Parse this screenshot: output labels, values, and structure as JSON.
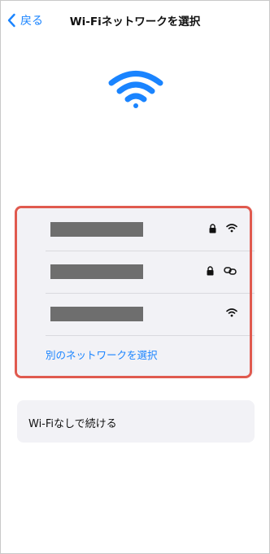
{
  "nav": {
    "back_label": "戻る",
    "title": "Wi-Fiネットワークを選択"
  },
  "hero": {
    "icon": "wifi-icon"
  },
  "networks": [
    {
      "ssid": "",
      "secured": true,
      "signal_icon": "wifi-icon"
    },
    {
      "ssid": "",
      "secured": true,
      "signal_icon": "link-icon"
    },
    {
      "ssid": "",
      "secured": false,
      "signal_icon": "wifi-icon"
    }
  ],
  "other_network_label": "別のネットワークを選択",
  "no_wifi_label": "Wi-Fiなしで続ける",
  "colors": {
    "accent": "#1a84ff",
    "highlight": "#e05a4f",
    "card_bg": "#f2f2f6",
    "redaction": "#6e6e6e"
  }
}
